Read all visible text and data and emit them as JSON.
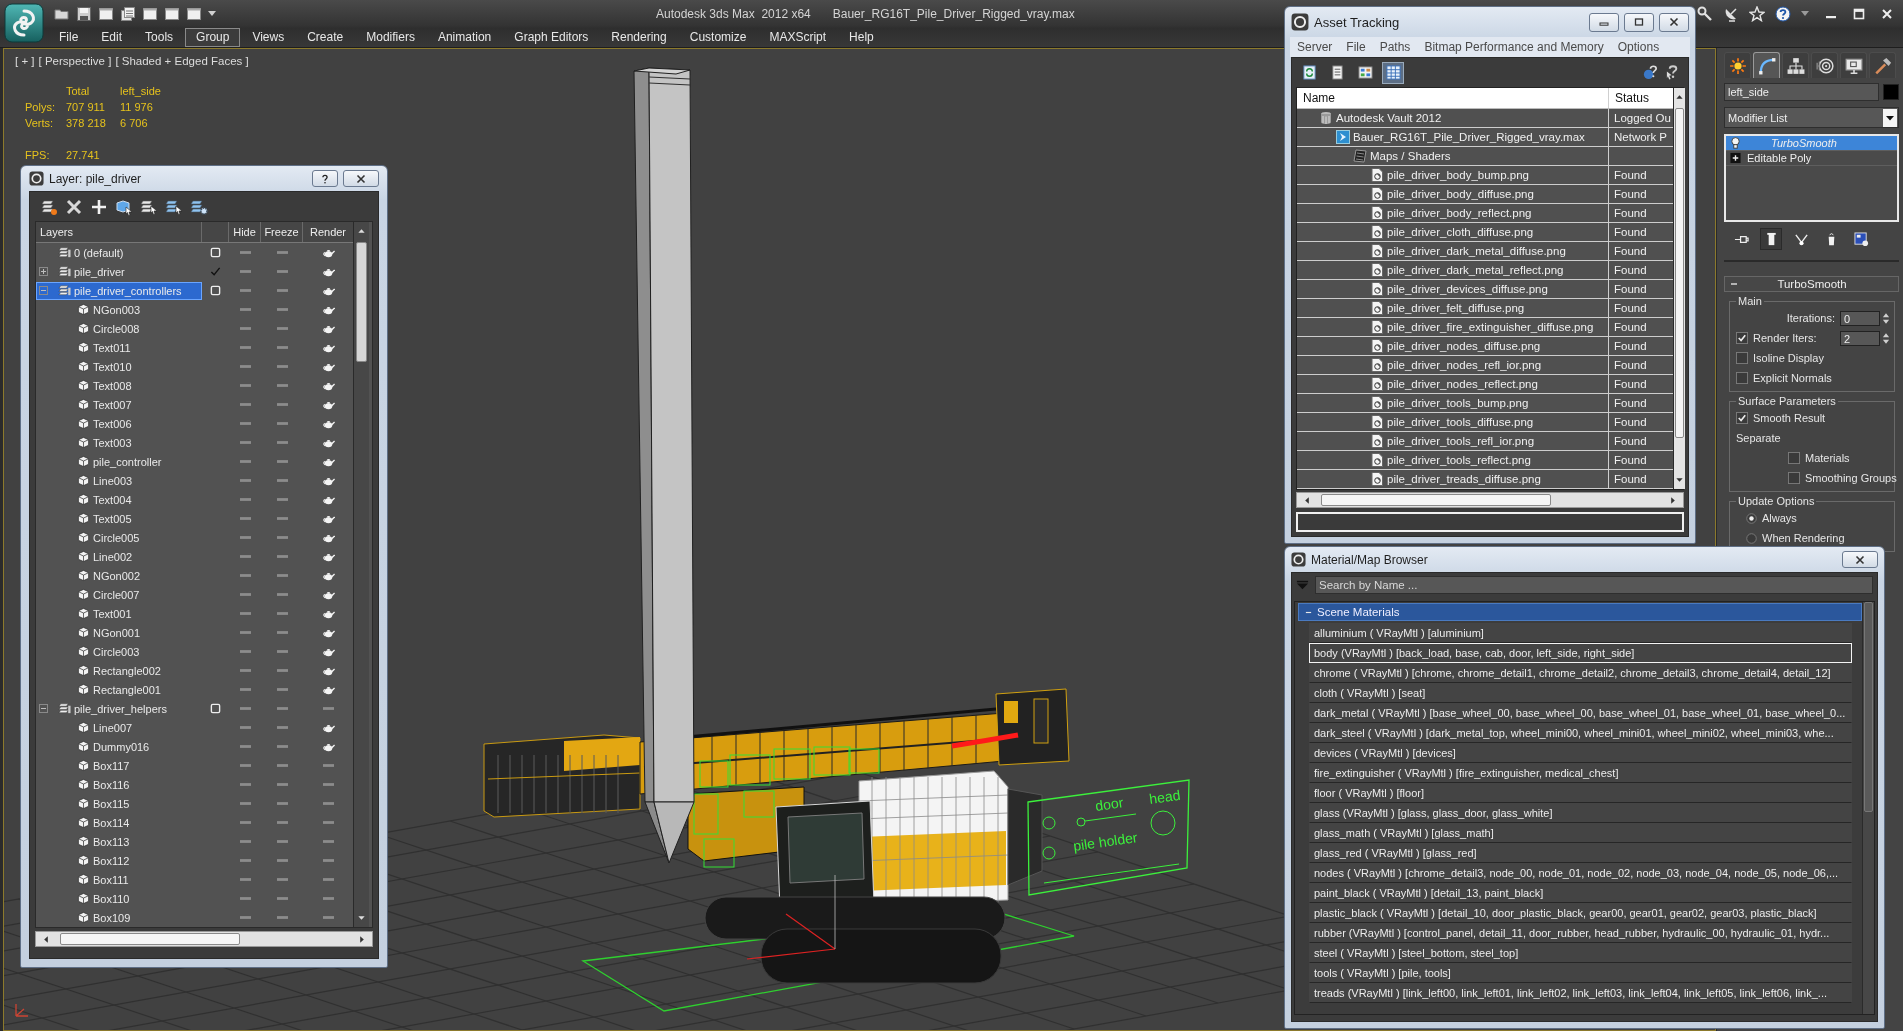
{
  "app": {
    "title": "Autodesk 3ds Max  2012 x64",
    "file": "Bauer_RG16T_Pile_Driver_Rigged_vray.max"
  },
  "menu": [
    {
      "label": "File",
      "selected": false
    },
    {
      "label": "Edit",
      "selected": false
    },
    {
      "label": "Tools",
      "selected": false
    },
    {
      "label": "Group",
      "selected": true
    },
    {
      "label": "Views",
      "selected": false
    },
    {
      "label": "Create",
      "selected": false
    },
    {
      "label": "Modifiers",
      "selected": false
    },
    {
      "label": "Animation",
      "selected": false
    },
    {
      "label": "Graph Editors",
      "selected": false
    },
    {
      "label": "Rendering",
      "selected": false
    },
    {
      "label": "Customize",
      "selected": false
    },
    {
      "label": "MAXScript",
      "selected": false
    },
    {
      "label": "Help",
      "selected": false
    }
  ],
  "viewport": {
    "menus": [
      "[ + ]",
      "[ Perspective ]",
      "[ Shaded + Edged Faces ]"
    ],
    "stats": {
      "columns": [
        "Total",
        "left_side"
      ],
      "rows": [
        {
          "label": "Polys:",
          "values": [
            "707 911",
            "11 976"
          ]
        },
        {
          "label": "Verts:",
          "values": [
            "378 218",
            "6 706"
          ]
        }
      ],
      "fps_label": "FPS:",
      "fps": "27.741"
    },
    "scene_labels": [
      "door",
      "head",
      "pile holder"
    ]
  },
  "layer_dialog": {
    "title": "Layer: pile_driver",
    "columns": [
      "Layers",
      "Hide",
      "Freeze",
      "Render"
    ],
    "layers": [
      {
        "label": "0 (default)",
        "kind": "layer",
        "selected": false,
        "current": false,
        "renderable": true
      },
      {
        "label": "pile_driver",
        "kind": "layer",
        "selected": false,
        "current": true,
        "renderable": true,
        "expanded": false
      },
      {
        "label": "pile_driver_controllers",
        "kind": "layer",
        "selected": true,
        "current": false,
        "renderable": true,
        "expanded": true,
        "children": [
          {
            "label": "NGon003",
            "kind": "object",
            "selected": false,
            "renderable": true
          },
          {
            "label": "Circle008",
            "kind": "object",
            "selected": false,
            "renderable": true
          },
          {
            "label": "Text011",
            "kind": "object",
            "selected": false,
            "renderable": true
          },
          {
            "label": "Text010",
            "kind": "object",
            "selected": false,
            "renderable": true
          },
          {
            "label": "Text008",
            "kind": "object",
            "selected": false,
            "renderable": true
          },
          {
            "label": "Text007",
            "kind": "object",
            "selected": false,
            "renderable": true
          },
          {
            "label": "Text006",
            "kind": "object",
            "selected": false,
            "renderable": true
          },
          {
            "label": "Text003",
            "kind": "object",
            "selected": false,
            "renderable": true
          },
          {
            "label": "pile_controller",
            "kind": "object",
            "selected": false,
            "renderable": true
          },
          {
            "label": "Line003",
            "kind": "object",
            "selected": false,
            "renderable": true
          },
          {
            "label": "Text004",
            "kind": "object",
            "selected": false,
            "renderable": true
          },
          {
            "label": "Text005",
            "kind": "object",
            "selected": false,
            "renderable": true
          },
          {
            "label": "Circle005",
            "kind": "object",
            "selected": false,
            "renderable": true
          },
          {
            "label": "Line002",
            "kind": "object",
            "selected": false,
            "renderable": true
          },
          {
            "label": "NGon002",
            "kind": "object",
            "selected": false,
            "renderable": true
          },
          {
            "label": "Circle007",
            "kind": "object",
            "selected": false,
            "renderable": true
          },
          {
            "label": "Text001",
            "kind": "object",
            "selected": false,
            "renderable": true
          },
          {
            "label": "NGon001",
            "kind": "object",
            "selected": false,
            "renderable": true
          },
          {
            "label": "Circle003",
            "kind": "object",
            "selected": false,
            "renderable": true
          },
          {
            "label": "Rectangle002",
            "kind": "object",
            "selected": false,
            "renderable": true
          },
          {
            "label": "Rectangle001",
            "kind": "object",
            "selected": false,
            "renderable": true
          }
        ]
      },
      {
        "label": "pile_driver_helpers",
        "kind": "layer",
        "selected": false,
        "current": false,
        "renderable": false,
        "expanded": true,
        "children": [
          {
            "label": "Line007",
            "kind": "object",
            "selected": false,
            "renderable": true
          },
          {
            "label": "Dummy016",
            "kind": "object",
            "selected": false,
            "renderable": true
          },
          {
            "label": "Box117",
            "kind": "object",
            "selected": false,
            "renderable": false
          },
          {
            "label": "Box116",
            "kind": "object",
            "selected": false,
            "renderable": false
          },
          {
            "label": "Box115",
            "kind": "object",
            "selected": false,
            "renderable": false
          },
          {
            "label": "Box114",
            "kind": "object",
            "selected": false,
            "renderable": false
          },
          {
            "label": "Box113",
            "kind": "object",
            "selected": false,
            "renderable": false
          },
          {
            "label": "Box112",
            "kind": "object",
            "selected": false,
            "renderable": false
          },
          {
            "label": "Box111",
            "kind": "object",
            "selected": false,
            "renderable": false
          },
          {
            "label": "Box110",
            "kind": "object",
            "selected": false,
            "renderable": false
          },
          {
            "label": "Box109",
            "kind": "object",
            "selected": false,
            "renderable": false
          }
        ]
      }
    ]
  },
  "asset_tracking": {
    "title": "Asset Tracking",
    "menu": [
      "Server",
      "File",
      "Paths",
      "Bitmap Performance and Memory",
      "Options"
    ],
    "view_buttons": [
      {
        "kind": "refresh",
        "selected": false
      },
      {
        "kind": "list",
        "selected": false
      },
      {
        "kind": "thumbnails",
        "selected": false
      },
      {
        "kind": "table",
        "selected": true
      }
    ],
    "columns": [
      "Name",
      "Status"
    ],
    "assets": [
      {
        "name": "Autodesk Vault 2012",
        "kind": "vault",
        "status": "Logged Ou",
        "children": [
          {
            "name": "Bauer_RG16T_Pile_Driver_Rigged_vray.max",
            "kind": "scene",
            "status": "Network P",
            "children": [
              {
                "name": "Maps / Shaders",
                "kind": "folder",
                "children": [
                  {
                    "name": "pile_driver_body_bump.png",
                    "kind": "bitmap",
                    "status": "Found"
                  },
                  {
                    "name": "pile_driver_body_diffuse.png",
                    "kind": "bitmap",
                    "status": "Found"
                  },
                  {
                    "name": "pile_driver_body_reflect.png",
                    "kind": "bitmap",
                    "status": "Found"
                  },
                  {
                    "name": "pile_driver_cloth_diffuse.png",
                    "kind": "bitmap",
                    "status": "Found"
                  },
                  {
                    "name": "pile_driver_dark_metal_diffuse.png",
                    "kind": "bitmap",
                    "status": "Found"
                  },
                  {
                    "name": "pile_driver_dark_metal_reflect.png",
                    "kind": "bitmap",
                    "status": "Found"
                  },
                  {
                    "name": "pile_driver_devices_diffuse.png",
                    "kind": "bitmap",
                    "status": "Found"
                  },
                  {
                    "name": "pile_driver_felt_diffuse.png",
                    "kind": "bitmap",
                    "status": "Found"
                  },
                  {
                    "name": "pile_driver_fire_extinguisher_diffuse.png",
                    "kind": "bitmap",
                    "status": "Found"
                  },
                  {
                    "name": "pile_driver_nodes_diffuse.png",
                    "kind": "bitmap",
                    "status": "Found"
                  },
                  {
                    "name": "pile_driver_nodes_refl_ior.png",
                    "kind": "bitmap",
                    "status": "Found"
                  },
                  {
                    "name": "pile_driver_nodes_reflect.png",
                    "kind": "bitmap",
                    "status": "Found"
                  },
                  {
                    "name": "pile_driver_tools_bump.png",
                    "kind": "bitmap",
                    "status": "Found"
                  },
                  {
                    "name": "pile_driver_tools_diffuse.png",
                    "kind": "bitmap",
                    "status": "Found"
                  },
                  {
                    "name": "pile_driver_tools_refl_ior.png",
                    "kind": "bitmap",
                    "status": "Found"
                  },
                  {
                    "name": "pile_driver_tools_reflect.png",
                    "kind": "bitmap",
                    "status": "Found"
                  },
                  {
                    "name": "pile_driver_treads_diffuse.png",
                    "kind": "bitmap",
                    "status": "Found"
                  }
                ]
              }
            ]
          }
        ]
      }
    ]
  },
  "command_panel": {
    "tabs": [
      {
        "kind": "create",
        "selected": false
      },
      {
        "kind": "modify",
        "selected": true
      },
      {
        "kind": "hierarchy",
        "selected": false
      },
      {
        "kind": "motion",
        "selected": false
      },
      {
        "kind": "display",
        "selected": false
      },
      {
        "kind": "utilities",
        "selected": false
      }
    ],
    "object_name": "left_side",
    "modifier_list": "Modifier List",
    "stack": [
      {
        "label": "TurboSmooth",
        "kind": "modifier",
        "selected": true
      },
      {
        "label": "Editable Poly",
        "kind": "base",
        "selected": false
      }
    ],
    "stack_tools": [
      {
        "kind": "pin",
        "on": false
      },
      {
        "kind": "end_result",
        "on": true
      },
      {
        "kind": "unique",
        "on": false
      },
      {
        "kind": "remove",
        "on": false
      },
      {
        "kind": "configure",
        "on": false
      }
    ],
    "rollout": {
      "title": "TurboSmooth",
      "expanded": true,
      "groups": [
        {
          "title": "Main",
          "controls": [
            {
              "kind": "spinner",
              "label": "Iterations:",
              "value": "0"
            },
            {
              "kind": "checkbox",
              "label": "Render Iters:",
              "checked": true,
              "value": "2"
            },
            {
              "kind": "checkbox",
              "label": "Isoline Display",
              "checked": false
            },
            {
              "kind": "checkbox",
              "label": "Explicit Normals",
              "checked": false
            }
          ]
        },
        {
          "title": "Surface Parameters",
          "controls": [
            {
              "kind": "checkbox",
              "label": "Smooth Result",
              "checked": true
            },
            {
              "kind": "label",
              "label": "Separate",
              "children": [
                {
                  "kind": "checkbox",
                  "label": "Materials",
                  "checked": false
                },
                {
                  "kind": "checkbox",
                  "label": "Smoothing Groups",
                  "checked": false
                }
              ]
            }
          ]
        },
        {
          "title": "Update Options",
          "controls": [
            {
              "kind": "radio",
              "label": "Always",
              "selected": true
            },
            {
              "kind": "radio",
              "label": "When Rendering",
              "selected": false
            }
          ]
        }
      ]
    }
  },
  "material_browser": {
    "title": "Material/Map Browser",
    "search": {
      "placeholder": "Search by Name ..."
    },
    "section": {
      "label": "Scene Materials",
      "expanded": true
    },
    "materials": [
      {
        "label": "alluminium ( VRayMtl ) [aluminium]",
        "selected": false
      },
      {
        "label": "body (VRayMtl ) [back_load, base, cab, door, left_side, right_side]",
        "selected": true
      },
      {
        "label": "chrome ( VRayMtl ) [chrome, chrome_detail1, chrome_detail2, chrome_detail3, chrome_detail4, detail_12]",
        "selected": false
      },
      {
        "label": "cloth ( VRayMtl ) [seat]",
        "selected": false
      },
      {
        "label": "dark_metal ( VRayMtl ) [base_wheel_00, base_wheel_00, base_wheel_01, base_wheel_01, base_wheel_0...",
        "selected": false
      },
      {
        "label": "dark_steel ( VRayMtl ) [dark_metal_top, wheel_mini00, wheel_mini01, wheel_mini02, wheel_mini03, whe...",
        "selected": false
      },
      {
        "label": "devices ( VRayMtl ) [devices]",
        "selected": false
      },
      {
        "label": "fire_extinguisher ( VRayMtl ) [fire_extinguisher, medical_chest]",
        "selected": false
      },
      {
        "label": "floor ( VRayMtl ) [floor]",
        "selected": false
      },
      {
        "label": "glass (VRayMtl ) [glass, glass_door, glass_white]",
        "selected": false
      },
      {
        "label": "glass_math ( VRayMtl ) [glass_math]",
        "selected": false
      },
      {
        "label": "glass_red ( VRayMtl ) [glass_red]",
        "selected": false
      },
      {
        "label": "nodes ( VRayMtl ) [chrome_detail3, node_00, node_01, node_02, node_03, node_04, node_05, node_06,...",
        "selected": false
      },
      {
        "label": "paint_black ( VRayMtl ) [detail_13, paint_black]",
        "selected": false
      },
      {
        "label": "plastic_black ( VRayMtl ) [detail_10, door_plastic_black, gear00, gear01, gear02, gear03, plastic_black]",
        "selected": false
      },
      {
        "label": "rubber (VRayMtl ) [control_panel, detail_11, door_rubber, head_rubber, hydraulic_00, hydraulic_01, hydr...",
        "selected": false
      },
      {
        "label": "steel ( VRayMtl ) [steel_bottom, steel_top]",
        "selected": false
      },
      {
        "label": "tools ( VRayMtl ) [pile, tools]",
        "selected": false
      },
      {
        "label": "treads (VRayMtl ) [link_left00, link_left01, link_left02, link_left03, link_left04, link_left05, link_left06, link_...",
        "selected": false
      }
    ]
  }
}
